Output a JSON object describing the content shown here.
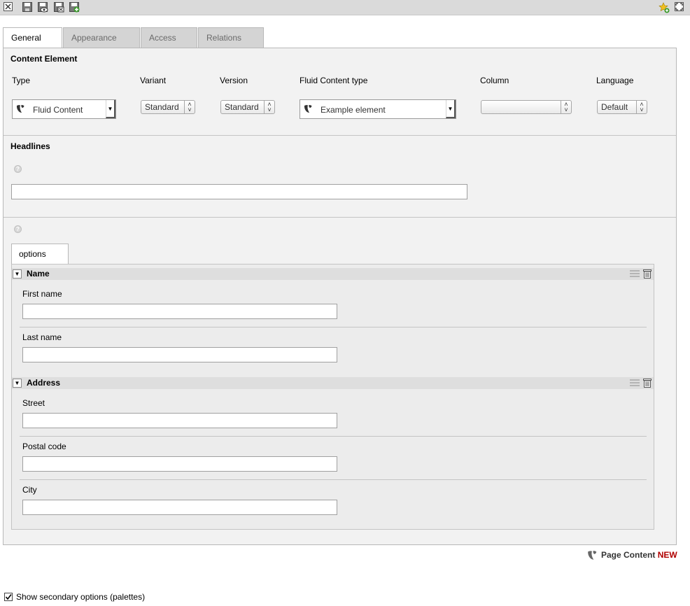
{
  "toolbar": {
    "icons": [
      "close-icon",
      "save-icon",
      "save-view-icon",
      "save-close-icon",
      "save-new-icon",
      "add-favorite-icon",
      "fullscreen-icon"
    ]
  },
  "tabs": [
    {
      "label": "General",
      "active": true
    },
    {
      "label": "Appearance",
      "active": false
    },
    {
      "label": "Access",
      "active": false
    },
    {
      "label": "Relations",
      "active": false
    }
  ],
  "content_element": {
    "title": "Content Element",
    "type": {
      "label": "Type",
      "value": "Fluid Content"
    },
    "variant": {
      "label": "Variant",
      "value": "Standard"
    },
    "version": {
      "label": "Version",
      "value": "Standard"
    },
    "fluid_type": {
      "label": "Fluid Content type",
      "value": "Example element"
    },
    "column": {
      "label": "Column",
      "value": ""
    },
    "language": {
      "label": "Language",
      "value": "Default"
    }
  },
  "headlines": {
    "title": "Headlines",
    "value": ""
  },
  "options": {
    "tab_label": "options",
    "sections": [
      {
        "title": "Name",
        "fields": [
          {
            "label": "First name",
            "value": ""
          },
          {
            "label": "Last name",
            "value": ""
          }
        ]
      },
      {
        "title": "Address",
        "fields": [
          {
            "label": "Street",
            "value": ""
          },
          {
            "label": "Postal code",
            "value": ""
          },
          {
            "label": "City",
            "value": ""
          }
        ]
      }
    ]
  },
  "footer": {
    "record_type": "Page Content",
    "status": "NEW"
  },
  "secondary_options": {
    "label": "Show secondary options (palettes)",
    "checked": true
  },
  "colors": {
    "panel_bg": "#f2f2f2",
    "toolbar_bg": "#dadada",
    "new_badge": "#b00000",
    "section_header_bg": "#dedede"
  }
}
